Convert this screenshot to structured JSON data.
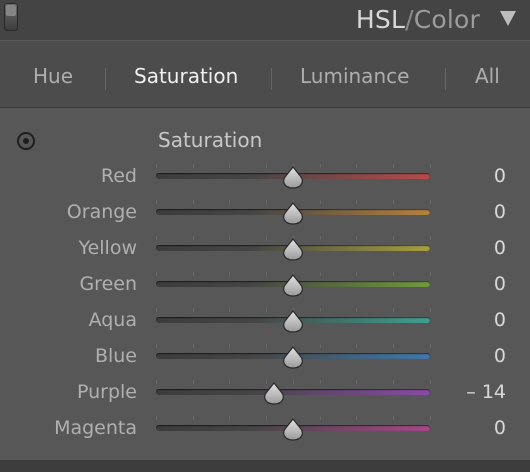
{
  "panel": {
    "title_main": "HSL",
    "title_sep": "/",
    "title_alt": "Color"
  },
  "tabs": [
    {
      "label": "Hue",
      "active": false
    },
    {
      "label": "Saturation",
      "active": true
    },
    {
      "label": "Luminance",
      "active": false
    },
    {
      "label": "All",
      "active": false
    }
  ],
  "section": {
    "title": "Saturation"
  },
  "sliders": [
    {
      "label": "Red",
      "value": "0",
      "level": 0,
      "color": "#b84a4a"
    },
    {
      "label": "Orange",
      "value": "0",
      "level": 0,
      "color": "#b5823e"
    },
    {
      "label": "Yellow",
      "value": "0",
      "level": 0,
      "color": "#a8a040"
    },
    {
      "label": "Green",
      "value": "0",
      "level": 0,
      "color": "#6f9a3c"
    },
    {
      "label": "Aqua",
      "value": "0",
      "level": 0,
      "color": "#3e9f8f"
    },
    {
      "label": "Blue",
      "value": "0",
      "level": 0,
      "color": "#3f78a8"
    },
    {
      "label": "Purple",
      "value": "– 14",
      "level": -14,
      "color": "#8a4aa6"
    },
    {
      "label": "Magenta",
      "value": "0",
      "level": 0,
      "color": "#a6478a"
    }
  ],
  "slider_range": [
    -100,
    100
  ],
  "icons": {
    "panel_toggle": "panel-toggle-switch",
    "collapse": "triangle-down-icon",
    "target_adjust": "target-adjustment-icon",
    "thumb": "slider-thumb-icon"
  }
}
